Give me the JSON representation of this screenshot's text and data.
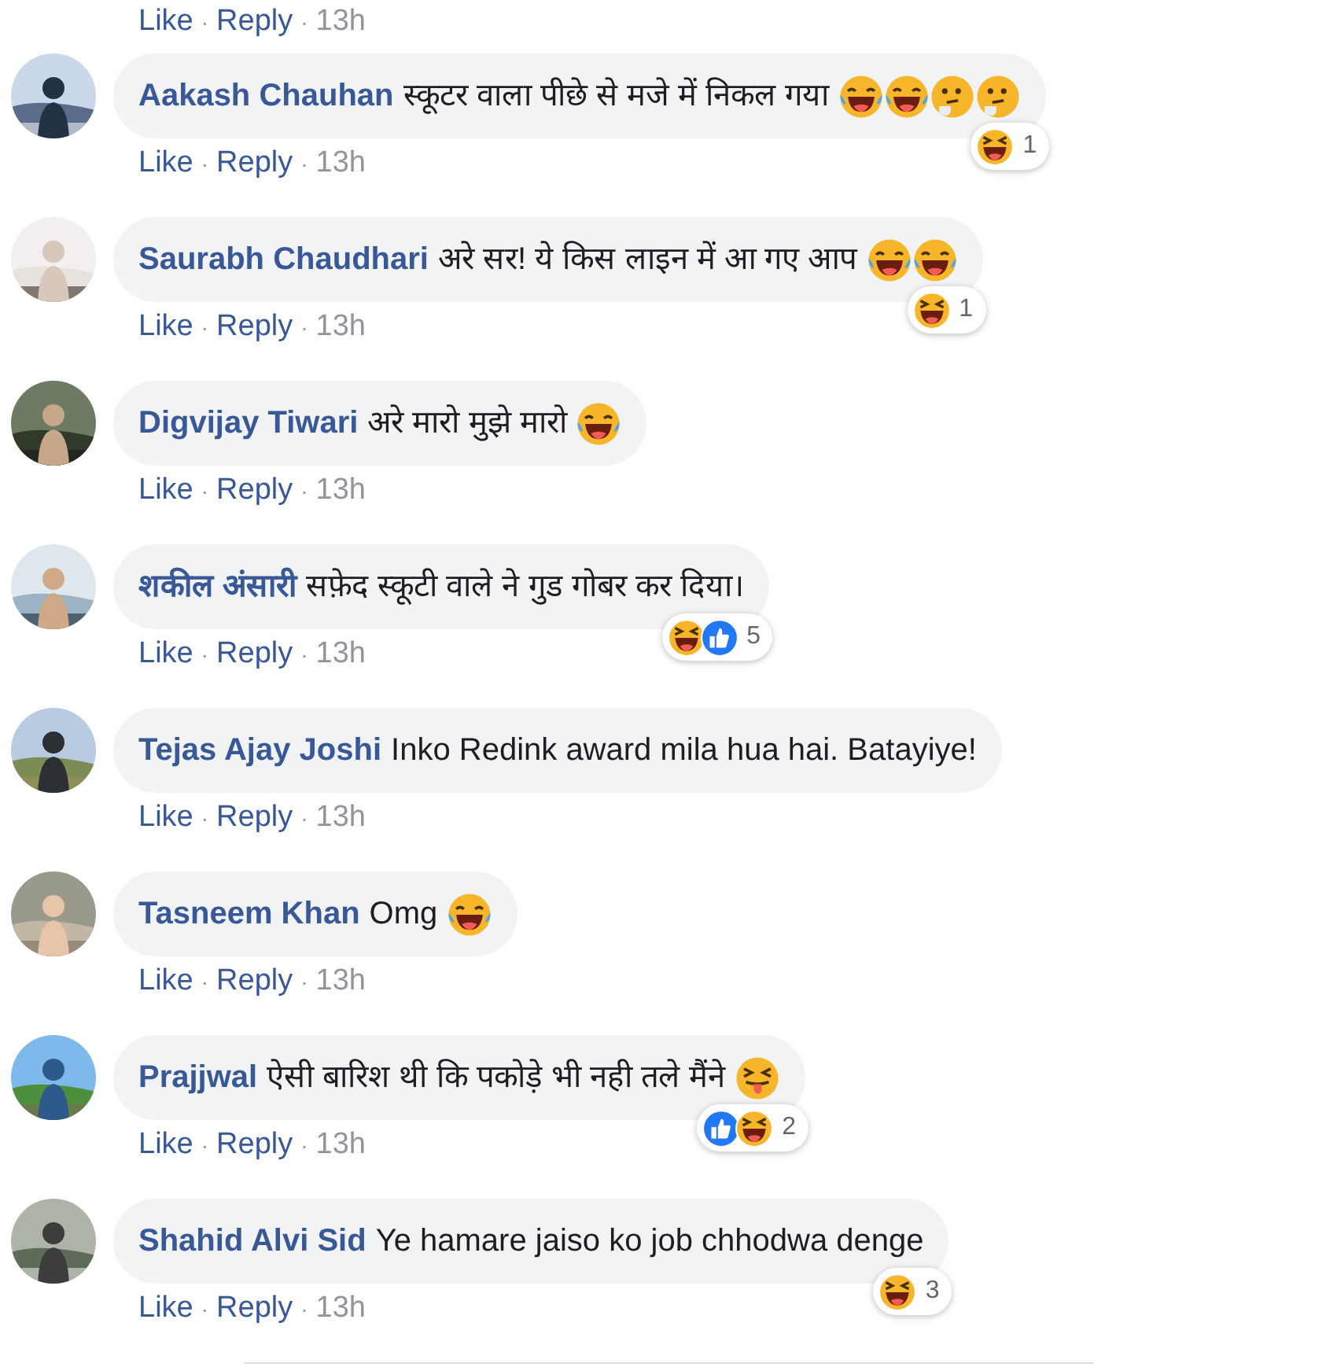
{
  "top_actions": [
    {
      "kind": "link",
      "text": "Like"
    },
    {
      "kind": "separator",
      "text": "·"
    },
    {
      "kind": "link",
      "text": "Reply"
    },
    {
      "kind": "separator",
      "text": "·"
    },
    {
      "kind": "time",
      "text": "13h"
    }
  ],
  "comments": [
    {
      "author": "Aakash Chauhan",
      "text": "स्कूटर वाला पीछे से मजे में निकल गया",
      "emojis": [
        {
          "kind": "tears-of-joy"
        },
        {
          "kind": "tears-of-joy"
        },
        {
          "kind": "thinking"
        },
        {
          "kind": "thinking"
        }
      ],
      "reactions": [
        {
          "kind": "haha"
        }
      ],
      "reaction_count": "1",
      "actions": [
        {
          "kind": "link",
          "text": "Like"
        },
        {
          "kind": "separator",
          "text": "·"
        },
        {
          "kind": "link",
          "text": "Reply"
        },
        {
          "kind": "separator",
          "text": "·"
        },
        {
          "kind": "time",
          "text": "13h"
        }
      ]
    },
    {
      "author": "Saurabh Chaudhari",
      "text": "अरे सर! ये किस लाइन में आ गए आप",
      "emojis": [
        {
          "kind": "tears-of-joy"
        },
        {
          "kind": "tears-of-joy"
        }
      ],
      "reactions": [
        {
          "kind": "haha"
        }
      ],
      "reaction_count": "1",
      "actions": [
        {
          "kind": "link",
          "text": "Like"
        },
        {
          "kind": "separator",
          "text": "·"
        },
        {
          "kind": "link",
          "text": "Reply"
        },
        {
          "kind": "separator",
          "text": "·"
        },
        {
          "kind": "time",
          "text": "13h"
        }
      ]
    },
    {
      "author": "Digvijay Tiwari",
      "text": "अरे मारो मुझे मारो",
      "emojis": [
        {
          "kind": "tears-of-joy"
        }
      ],
      "actions": [
        {
          "kind": "link",
          "text": "Like"
        },
        {
          "kind": "separator",
          "text": "·"
        },
        {
          "kind": "link",
          "text": "Reply"
        },
        {
          "kind": "separator",
          "text": "·"
        },
        {
          "kind": "time",
          "text": "13h"
        }
      ]
    },
    {
      "author": "शकील अंसारी",
      "text": "सफ़ेद स्कूटी वाले ने गुड गोबर कर दिया।",
      "reactions": [
        {
          "kind": "haha"
        },
        {
          "kind": "like"
        }
      ],
      "reaction_count": "5",
      "actions": [
        {
          "kind": "link",
          "text": "Like"
        },
        {
          "kind": "separator",
          "text": "·"
        },
        {
          "kind": "link",
          "text": "Reply"
        },
        {
          "kind": "separator",
          "text": "·"
        },
        {
          "kind": "time",
          "text": "13h"
        }
      ]
    },
    {
      "author": "Tejas Ajay Joshi",
      "text": "Inko Redink award mila hua hai. Batayiye!",
      "actions": [
        {
          "kind": "link",
          "text": "Like"
        },
        {
          "kind": "separator",
          "text": "·"
        },
        {
          "kind": "link",
          "text": "Reply"
        },
        {
          "kind": "separator",
          "text": "·"
        },
        {
          "kind": "time",
          "text": "13h"
        }
      ]
    },
    {
      "author": "Tasneem Khan",
      "text": "Omg",
      "emojis": [
        {
          "kind": "tears-of-joy"
        }
      ],
      "actions": [
        {
          "kind": "link",
          "text": "Like"
        },
        {
          "kind": "separator",
          "text": "·"
        },
        {
          "kind": "link",
          "text": "Reply"
        },
        {
          "kind": "separator",
          "text": "·"
        },
        {
          "kind": "time",
          "text": "13h"
        }
      ]
    },
    {
      "author": "Prajjwal",
      "text": "ऐसी बारिश थी कि पकोड़े भी नही तले मैंने",
      "emojis": [
        {
          "kind": "squint-tongue"
        }
      ],
      "reactions": [
        {
          "kind": "like"
        },
        {
          "kind": "haha"
        }
      ],
      "reaction_count": "2",
      "actions": [
        {
          "kind": "link",
          "text": "Like"
        },
        {
          "kind": "separator",
          "text": "·"
        },
        {
          "kind": "link",
          "text": "Reply"
        },
        {
          "kind": "separator",
          "text": "·"
        },
        {
          "kind": "time",
          "text": "13h"
        }
      ]
    },
    {
      "author": "Shahid Alvi Sid",
      "text": "Ye hamare jaiso ko job chhodwa denge",
      "reactions": [
        {
          "kind": "haha"
        }
      ],
      "reaction_count": "3",
      "actions": [
        {
          "kind": "link",
          "text": "Like"
        },
        {
          "kind": "separator",
          "text": "·"
        },
        {
          "kind": "link",
          "text": "Reply"
        },
        {
          "kind": "separator",
          "text": "·"
        },
        {
          "kind": "time",
          "text": "13h"
        }
      ]
    }
  ]
}
